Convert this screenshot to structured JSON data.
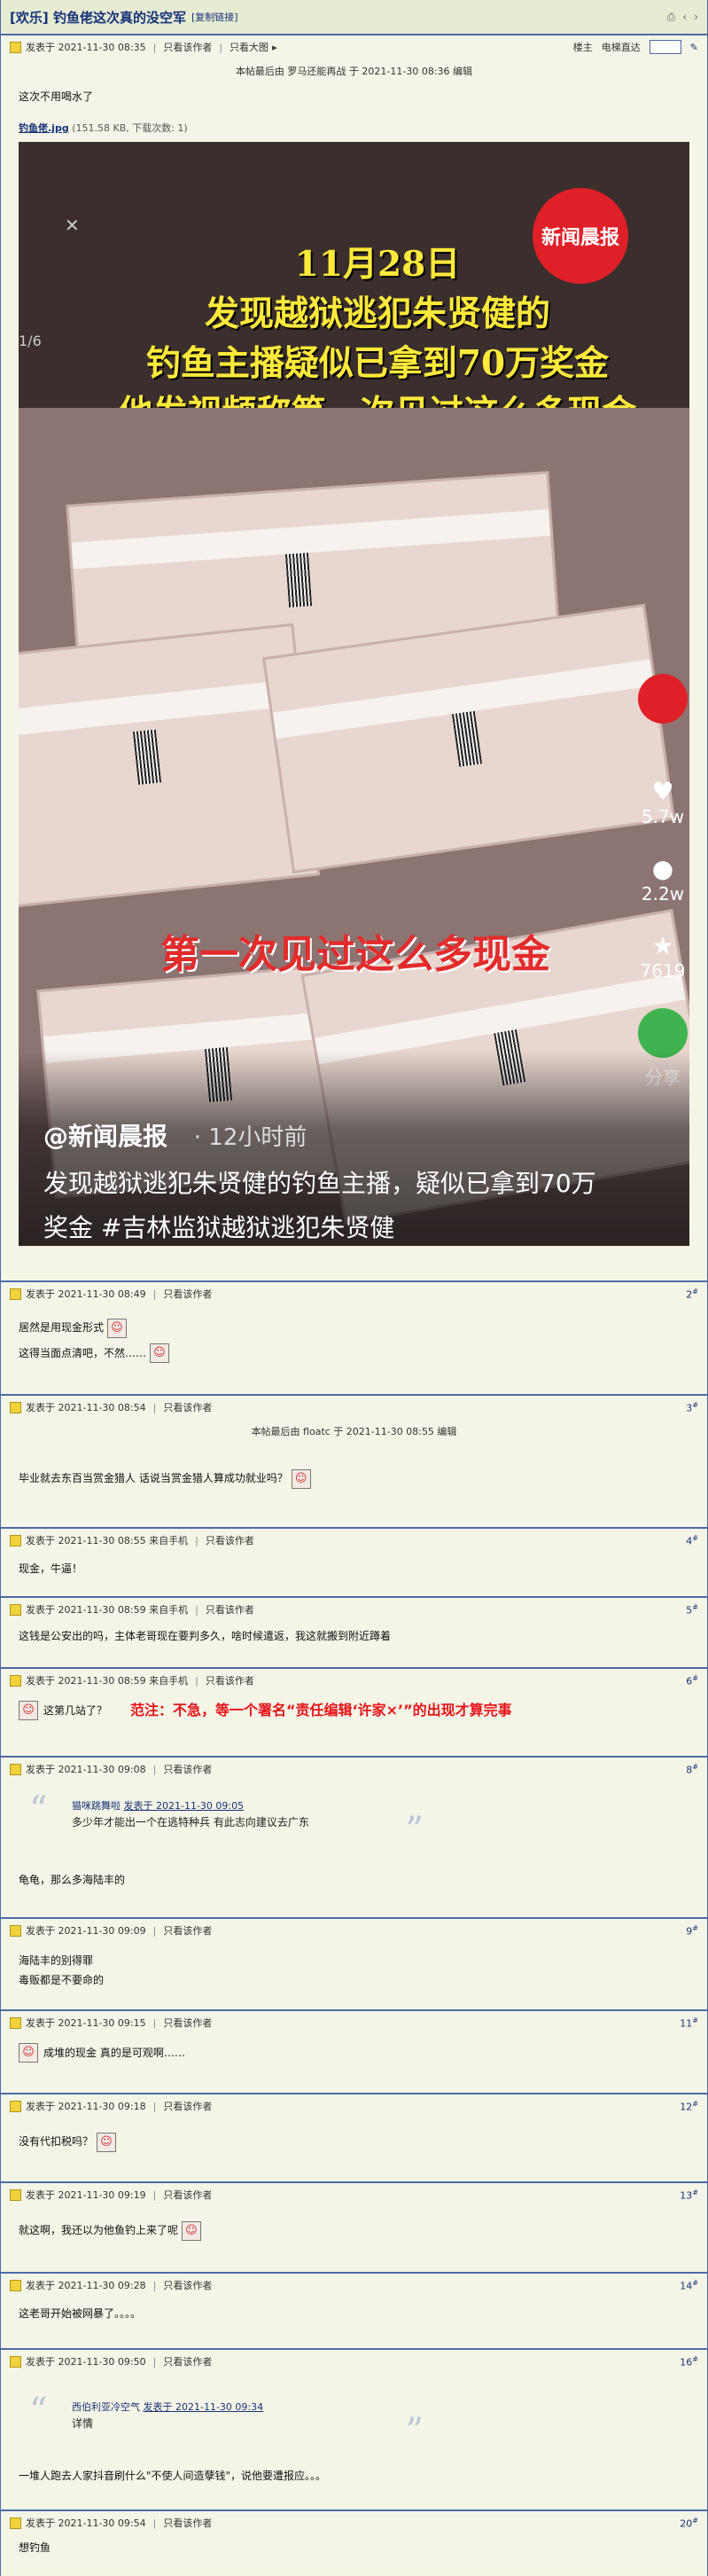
{
  "thread": {
    "category": "[欢乐]",
    "title": "钓鱼佬这次真的没空军",
    "copy_link": "[复制链接]",
    "icons": [
      "print-icon",
      "prev-icon",
      "next-icon"
    ]
  },
  "posts": [
    {
      "posted": "发表于 2021-11-30 08:35",
      "author_only": "只看该作者",
      "view_large": "只看大图",
      "floor_label": "楼主",
      "browse_mode": "电梯直达",
      "edited": "本帖最后由 罗马还能再战 于 2021-11-30 08:36 编辑",
      "text": "这次不用喝水了",
      "attach_name": "钓鱼佬.jpg",
      "attach_info": "(151.58 KB, 下载次数: 1)",
      "image": {
        "headline": [
          "11月28日",
          "发现越狱逃犯朱贤健的",
          "钓鱼主播疑似已拿到70万奖金",
          "他发视频称第一次见过这么多现金"
        ],
        "logo": "新闻晨报",
        "counter": "1/6",
        "mid_text": "第一次见过这么多现金",
        "likes": "5.7w",
        "comments": "2.2w",
        "favorites": "7619",
        "share": "分享",
        "account": "@新闻晨报",
        "time": "·  12小时前",
        "caption": "发现越狱逃犯朱贤健的钓鱼主播，疑似已拿到70万奖金 #吉林监狱越狱逃犯朱贤健"
      }
    },
    {
      "posted": "发表于 2021-11-30 08:49",
      "author_only": "只看该作者",
      "floor": "2",
      "lines": [
        "居然是用现金形式",
        "这得当面点清吧，不然……"
      ]
    },
    {
      "posted": "发表于 2021-11-30 08:54",
      "author_only": "只看该作者",
      "floor": "3",
      "edited": "本帖最后由 floatc 于 2021-11-30 08:55 编辑",
      "lines": [
        "毕业就去东百当赏金猎人 话说当赏金猎人算成功就业吗？"
      ]
    },
    {
      "posted": "发表于 2021-11-30 08:55 来自手机",
      "author_only": "只看该作者",
      "floor": "4",
      "lines": [
        "现金，牛逼！"
      ]
    },
    {
      "posted": "发表于 2021-11-30 08:59 来自手机",
      "author_only": "只看该作者",
      "floor": "5",
      "lines": [
        "这钱是公安出的吗，主体老哥现在要判多久，啥时候遣返，我这就搬到附近蹲着"
      ]
    },
    {
      "posted": "发表于 2021-11-30 08:59 来自手机",
      "author_only": "只看该作者",
      "floor": "6",
      "lines": [
        "这第几站了？"
      ],
      "red": "范注：不急，等一个署名“责任编辑‘许家×’”的出现才算完事"
    },
    {
      "posted": "发表于 2021-11-30 09:08",
      "author_only": "只看该作者",
      "floor": "8",
      "quote_author": "猫咪跳舞啦",
      "quote_time": "发表于 2021-11-30 09:05",
      "quote_text": "多少年才能出一个在逃特种兵 有此志向建议去广东",
      "lines": [
        "龟龟，那么多海陆丰的"
      ]
    },
    {
      "posted": "发表于 2021-11-30 09:09",
      "author_only": "只看该作者",
      "floor": "9",
      "lines": [
        "海陆丰的别得罪",
        "毒贩都是不要命的"
      ]
    },
    {
      "posted": "发表于 2021-11-30 09:15",
      "author_only": "只看该作者",
      "floor": "11",
      "lines": [
        "成堆的现金 真的是可观啊……"
      ]
    },
    {
      "posted": "发表于 2021-11-30 09:18",
      "author_only": "只看该作者",
      "floor": "12",
      "lines": [
        "没有代扣税吗？"
      ]
    },
    {
      "posted": "发表于 2021-11-30 09:19",
      "author_only": "只看该作者",
      "floor": "13",
      "lines": [
        "就这啊，我还以为他鱼钓上来了呢"
      ]
    },
    {
      "posted": "发表于 2021-11-30 09:28",
      "author_only": "只看该作者",
      "floor": "14",
      "lines": [
        "这老哥开始被网暴了。。。。"
      ]
    },
    {
      "posted": "发表于 2021-11-30 09:50",
      "author_only": "只看该作者",
      "floor": "16",
      "quote_author": "西伯利亚冷空气",
      "quote_time": "发表于 2021-11-30 09:34",
      "quote_text": "详情",
      "lines": [
        "一堆人跑去人家抖音刷什么\"不使人间造孽钱\"，说他要遭报应。。。"
      ]
    },
    {
      "posted": "发表于 2021-11-30 09:54",
      "author_only": "只看该作者",
      "floor": "20",
      "lines": [
        "想钓鱼"
      ]
    }
  ]
}
